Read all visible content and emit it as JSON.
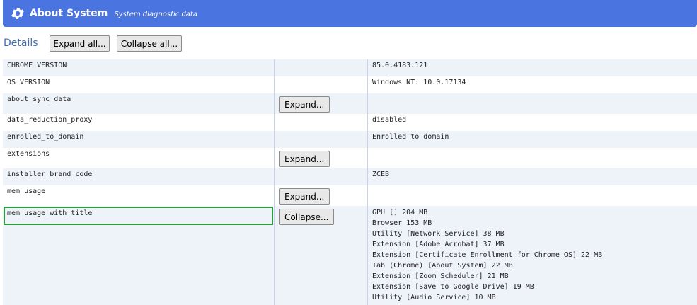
{
  "header": {
    "title": "About System",
    "subtitle": "System diagnostic data",
    "icon": "gear-icon",
    "bg_color": "#4a74e0"
  },
  "toolbar": {
    "details_label": "Details",
    "expand_all_label": "Expand all...",
    "collapse_all_label": "Collapse all..."
  },
  "rows": [
    {
      "key": "CHROME VERSION",
      "value": "85.0.4183.121"
    },
    {
      "key": "OS VERSION",
      "value": "Windows NT: 10.0.17134"
    },
    {
      "key": "about_sync_data",
      "button": "Expand..."
    },
    {
      "key": "data_reduction_proxy",
      "value": "disabled"
    },
    {
      "key": "enrolled_to_domain",
      "value": "Enrolled to domain"
    },
    {
      "key": "extensions",
      "button": "Expand..."
    },
    {
      "key": "installer_brand_code",
      "value": "ZCEB"
    },
    {
      "key": "mem_usage",
      "button": "Expand..."
    },
    {
      "key": "mem_usage_with_title",
      "button": "Collapse...",
      "highlighted": true,
      "value_lines": [
        "GPU [] 204 MB",
        "Browser 153 MB",
        "Utility [Network Service] 38 MB",
        "Extension [Adobe Acrobat] 37 MB",
        "Extension [Certificate Enrollment for Chrome OS] 22 MB",
        "Tab (Chrome) [About System] 22 MB",
        "Extension [Zoom Scheduler] 21 MB",
        "Extension [Save to Google Drive] 19 MB",
        "Utility [Audio Service] 10 MB"
      ]
    }
  ]
}
